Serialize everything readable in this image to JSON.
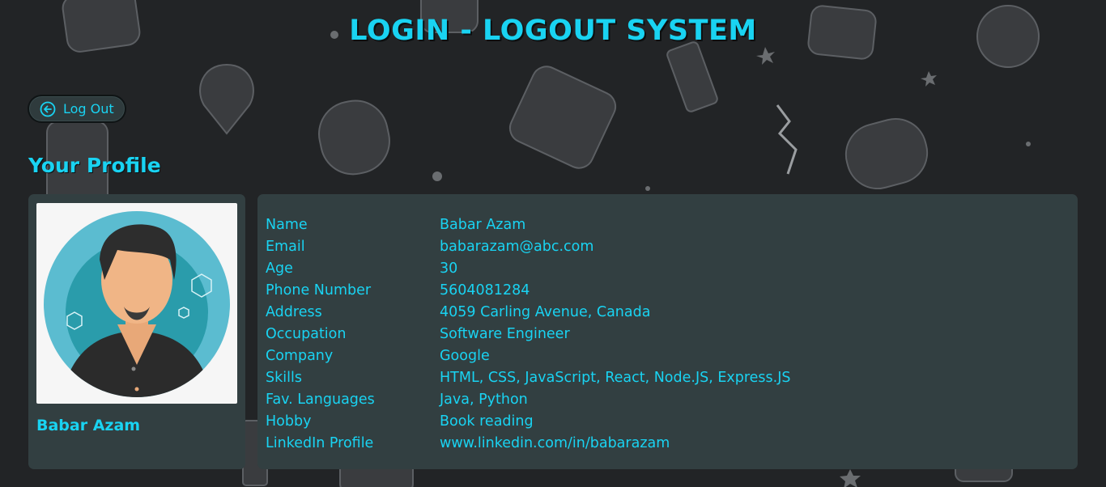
{
  "header": {
    "title": "LOGIN - LOGOUT SYSTEM"
  },
  "logout_button": {
    "label": "Log Out",
    "icon": "arrow-left-circle-icon"
  },
  "section": {
    "title": "Your Profile"
  },
  "profile_card": {
    "name": "Babar Azam",
    "avatar": "avatar-man-illustration"
  },
  "details": [
    {
      "label": "Name",
      "value": "Babar Azam"
    },
    {
      "label": "Email",
      "value": "babarazam@abc.com"
    },
    {
      "label": "Age",
      "value": "30"
    },
    {
      "label": "Phone Number",
      "value": "5604081284"
    },
    {
      "label": "Address",
      "value": "4059 Carling Avenue, Canada"
    },
    {
      "label": "Occupation",
      "value": "Software Engineer"
    },
    {
      "label": "Company",
      "value": "Google"
    },
    {
      "label": "Skills",
      "value": "HTML, CSS, JavaScript, React, Node.JS, Express.JS"
    },
    {
      "label": "Fav. Languages",
      "value": "Java, Python"
    },
    {
      "label": "Hobby",
      "value": "Book reading"
    },
    {
      "label": "LinkedIn Profile",
      "value": "www.linkedin.com/in/babarazam"
    }
  ],
  "colors": {
    "accent": "#19d3f2",
    "background": "#222426",
    "card": "#323f41"
  }
}
